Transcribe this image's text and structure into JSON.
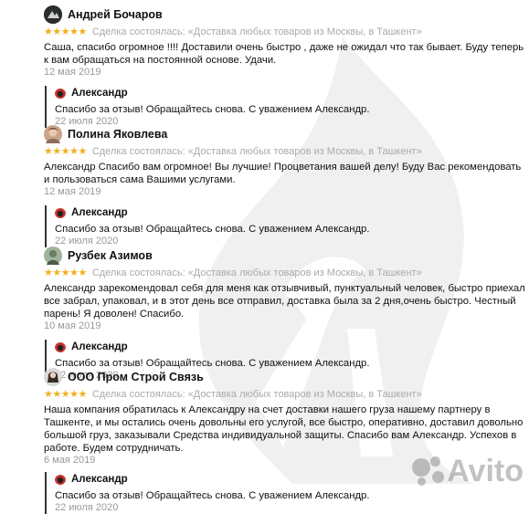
{
  "reviews": [
    {
      "name": "Андрей Бочаров",
      "stars": "★★★★★",
      "deal": "Сделка состоялась: «Доставка любых товаров из Москвы, в Ташкент»",
      "text": "Саша, спасибо огромное !!!! Доставили очень быстро , даже не ожидал что так бывает. Буду теперь к вам обращаться на постоянной основе. Удачи.",
      "date": "12 мая 2019",
      "reply": {
        "name": "Александр",
        "text": "Спасибо за отзыв! Обращайтесь снова. С уважением Александр.",
        "date": "22 июля 2020"
      }
    },
    {
      "name": "Полина Яковлева",
      "stars": "★★★★★",
      "deal": "Сделка состоялась: «Доставка любых товаров из Москвы, в Ташкент»",
      "text": "Александр Спасибо вам огромное! Вы лучшие! Процветания вашей делу! Буду Вас рекомендовать и пользоваться сама Вашими услугами.",
      "date": "12 мая 2019",
      "reply": {
        "name": "Александр",
        "text": "Спасибо за отзыв! Обращайтесь снова. С уважением Александр.",
        "date": "22 июля 2020"
      }
    },
    {
      "name": "Рузбек Азимов",
      "stars": "★★★★★",
      "deal": "Сделка состоялась: «Доставка любых товаров из Москвы, в Ташкент»",
      "text": "Александр зарекомендовал себя для меня как отзывчивый, пунктуальный человек, быстро приехал все забрал, упаковал, и в этот день все отправил, доставка была за 2 дня,очень быстро. Честный парень! Я доволен! Спасибо.",
      "date": "10 мая 2019",
      "reply": {
        "name": "Александр",
        "text": "Спасибо за отзыв! Обращайтесь снова. С уважением Александр.",
        "date": "22 июля 2020"
      }
    },
    {
      "name": "ООО Пром Строй Связь",
      "stars": "★★★★★",
      "deal": "Сделка состоялась: «Доставка любых товаров из Москвы, в Ташкент»",
      "text": "Наша компания обратилась к Александру на счет доставки нашего груза нашему партнеру в Ташкенте, и мы остались очень довольны его услугой, все быстро, оперативно, доставил довольно большой груз, заказывали Средства индивидуальной защиты. Спасибо вам Александр. Успехов в работе. Будем сотрудничать.",
      "date": "6 мая 2019",
      "reply": {
        "name": "Александр",
        "text": "Спасибо за отзыв! Обращайтесь снова. С уважением Александр.",
        "date": "22 июля 2020"
      }
    }
  ],
  "watermark": {
    "brand": "Avito"
  },
  "colors": {
    "stars": "#f2b01e",
    "meta": "#aaaaaa",
    "date": "#999999"
  }
}
